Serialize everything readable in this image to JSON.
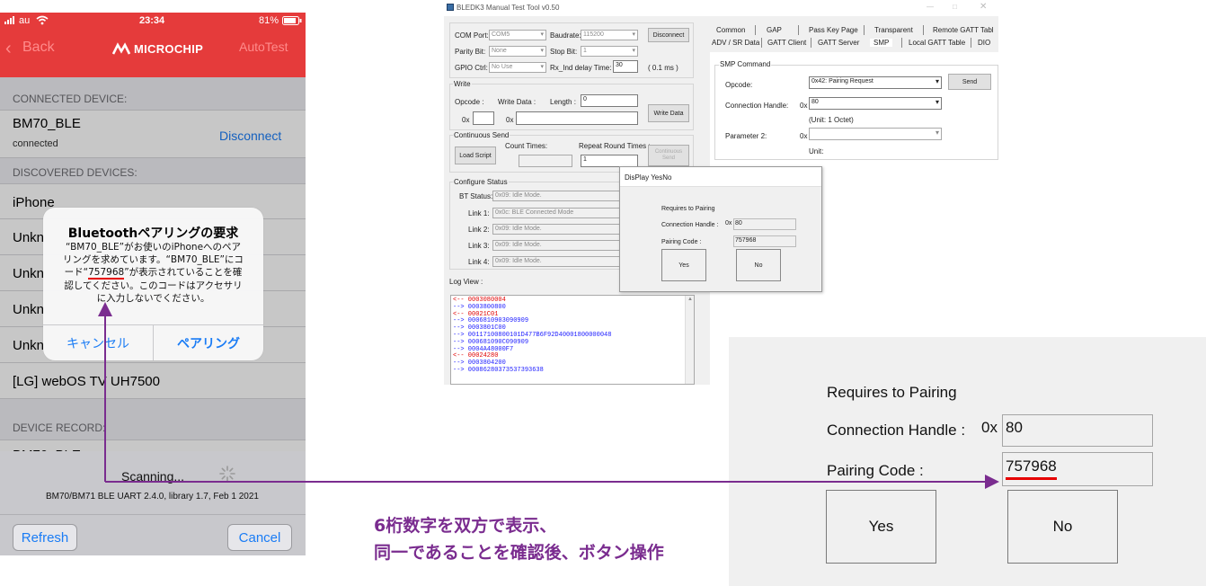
{
  "phone": {
    "carrier": "au",
    "time": "23:34",
    "battery": "81%",
    "back": "Back",
    "brand": "MICROCHIP",
    "autotest": "AutoTest",
    "connected_header": "CONNECTED DEVICE:",
    "connected_name": "BM70_BLE",
    "connected_status": "connected",
    "disconnect": "Disconnect",
    "discovered_header": "DISCOVERED DEVICES:",
    "devices": [
      "iPhone",
      "Unkn",
      "Unkn",
      "Unkn",
      "Unkn",
      "[LG] webOS TV UH7500"
    ],
    "record_header": "DEVICE RECORD:",
    "record_partial": "BM70_BLE",
    "scanning": "Scanning...",
    "footer": "BM70/BM71 BLE UART 2.4.0, library 1.7, Feb  1 2021",
    "refresh": "Refresh",
    "cancel": "Cancel"
  },
  "alert": {
    "title": "Bluetoothペアリングの要求",
    "line1": "“BM70_BLE”がお使いのiPhoneへのペア",
    "line2": "リングを求めています。“BM70_BLE”にコ",
    "line3a": "ード“",
    "code": "757968",
    "line3b": "”が表示されていることを確",
    "line4": "認してください。このコードはアクセサリ",
    "line5": "に入力しないでください。",
    "cancel": "キャンセル",
    "pair": "ペアリング"
  },
  "tool": {
    "title": "BLEDK3 Manual Test Tool v0.50",
    "com_port_label": "COM Port:",
    "com_port": "COM5",
    "baud_label": "Baudrate:",
    "baud": "115200",
    "disconnect": "Disconnect",
    "parity_label": "Parity Bit:",
    "parity": "None",
    "stop_label": "Stop Bit:",
    "stop": "1",
    "gpio_label": "GPIO Ctrl:",
    "gpio": "No Use",
    "rx_label": "Rx_Ind delay Time:",
    "rx": "30",
    "rx_unit": "( 0.1 ms )",
    "write_group": "Write",
    "opcode_label": "Opcode :",
    "write_data_label": "Write Data :",
    "length_label": "Length :",
    "length": "0",
    "ox": "0x",
    "write_data_btn": "Write Data",
    "cont_group": "Continuous Send",
    "count_label": "Count Times:",
    "repeat_label": "Repeat Round Times :",
    "repeat": "1",
    "load_script": "Load Script",
    "cont_send": "Continuous Send",
    "cfg_group": "Configure Status",
    "bt_status_label": "BT Status:",
    "bt_status": "0x09: Idle Mode.",
    "links": [
      {
        "label": "Link 1:",
        "value": "0x0c: BLE Connected Mode"
      },
      {
        "label": "Link 2:",
        "value": "0x09: Idle Mode."
      },
      {
        "label": "Link 3:",
        "value": "0x09: Idle Mode."
      },
      {
        "label": "Link 4:",
        "value": "0x09: Idle Mode."
      }
    ],
    "log_label": "Log View :",
    "log": [
      {
        "t": "<-- 0003080004",
        "c": "#e00000"
      },
      {
        "t": "--> 0003800800",
        "c": "#1a1aff"
      },
      {
        "t": "<-- 00021C01",
        "c": "#e00000"
      },
      {
        "t": "--> 0006810903090909",
        "c": "#1a1aff"
      },
      {
        "t": "--> 0003801C00",
        "c": "#1a1aff"
      },
      {
        "t": "--> 00117100800101D477B6F92D40001800000048",
        "c": "#1a1aff"
      },
      {
        "t": "--> 000681090C090909",
        "c": "#1a1aff"
      },
      {
        "t": "--> 0004A48000F7",
        "c": "#1a1aff"
      },
      {
        "t": "<-- 00024280",
        "c": "#e00000"
      },
      {
        "t": "--> 0003804200",
        "c": "#1a1aff"
      },
      {
        "t": "--> 00086280373537393638",
        "c": "#1a1aff"
      }
    ],
    "tabs_row1": [
      "Common",
      "GAP",
      "Pass Key Page",
      "Transparent",
      "Remote GATT Tabl"
    ],
    "tabs_row2": [
      "ADV / SR Data",
      "GATT Client",
      "GATT Server",
      "SMP",
      "Local GATT Table",
      "DIO"
    ],
    "smp_group": "SMP Command",
    "opcode_label2": "Opcode:",
    "opcode_value": "0x42: Pairing Request",
    "send": "Send",
    "conn_handle_label": "Connection Handle:",
    "conn_handle": "80",
    "conn_unit": "(Unit: 1 Octet)",
    "param2_label": "Parameter 2:",
    "unit_label": "Unit:"
  },
  "dialog": {
    "title": "DisPlay YesNo",
    "req": "Requires to Pairing",
    "conn_label": "Connection Handle :",
    "ox": "0x",
    "conn": "80",
    "code_label": "Pairing Code :",
    "code": "757968",
    "yes": "Yes",
    "no": "No"
  },
  "zoom": {
    "req": "Requires to Pairing",
    "conn_label": "Connection Handle :",
    "ox": "0x",
    "conn": "80",
    "code_label": "Pairing Code :",
    "code": "757968",
    "yes": "Yes",
    "no": "No"
  },
  "caption": {
    "line1": "6桁数字を双方で表示、",
    "line2": "同一であることを確認後、ボタン操作"
  },
  "colors": {
    "ios_red": "#e53b3b",
    "ios_blue": "#1a7cf5",
    "annotation_purple": "#7a2c8f",
    "underline_red": "#e60000"
  }
}
